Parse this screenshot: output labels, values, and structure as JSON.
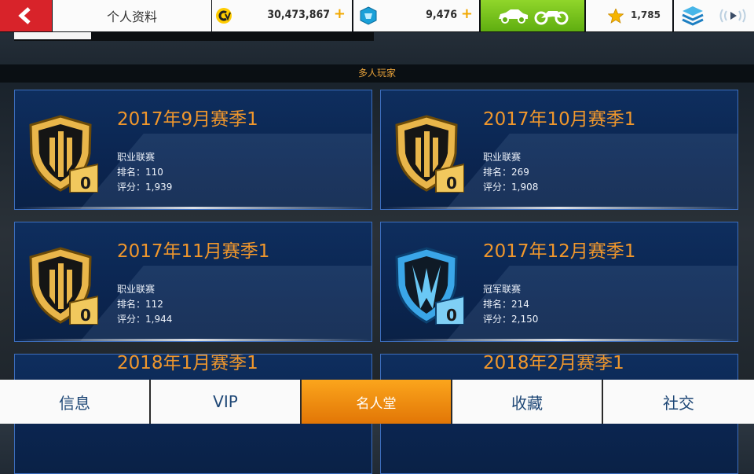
{
  "header": {
    "back_icon": "back-arrow-icon",
    "title": "个人资料",
    "credits": "30,473,867",
    "tokens": "9,476",
    "plus": "+",
    "garage_icons": [
      "car-icon",
      "motorbike-icon"
    ],
    "stars": "1,785"
  },
  "section": {
    "title": "多人玩家"
  },
  "cards": [
    {
      "season": "2017年9月赛季1",
      "league": "职业联赛",
      "rank": "排名：110",
      "score": "评分：1,939",
      "badge": "gold",
      "badge_count": "0"
    },
    {
      "season": "2017年10月赛季1",
      "league": "职业联赛",
      "rank": "排名：269",
      "score": "评分：1,908",
      "badge": "gold",
      "badge_count": "0"
    },
    {
      "season": "2017年11月赛季1",
      "league": "职业联赛",
      "rank": "排名：112",
      "score": "评分：1,944",
      "badge": "gold",
      "badge_count": "0"
    },
    {
      "season": "2017年12月赛季1",
      "league": "冠军联赛",
      "rank": "排名：214",
      "score": "评分：2,150",
      "badge": "blue",
      "badge_count": "0"
    },
    {
      "season": "2018年1月赛季1"
    },
    {
      "season": "2018年2月赛季1"
    }
  ],
  "tabs": [
    {
      "label": "信息",
      "active": false
    },
    {
      "label": "VIP",
      "active": false
    },
    {
      "label": "名人堂",
      "active": true
    },
    {
      "label": "收藏",
      "active": false
    },
    {
      "label": "社交",
      "active": false
    }
  ],
  "colors": {
    "accent": "#f0972c",
    "back": "#d8232a",
    "garage": "#74c21a",
    "tab_active": "#f08a10",
    "card_border": "#3d6fbf"
  }
}
